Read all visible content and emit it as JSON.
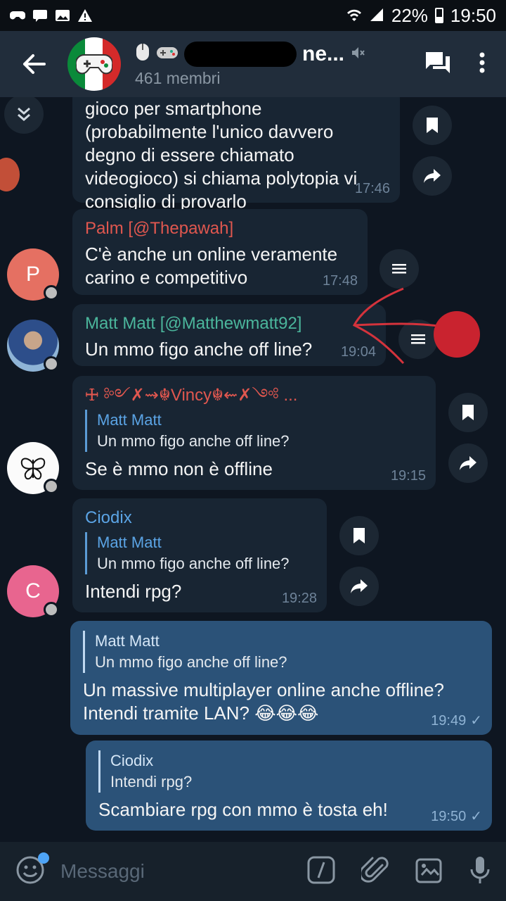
{
  "status_bar": {
    "battery": "22%",
    "time": "19:50"
  },
  "header": {
    "title_visible": "ne...",
    "subtitle": "461 membri"
  },
  "messages": [
    {
      "text": "gioco per smartphone (probabilmente l'unico davvero degno di essere chiamato videogioco) si chiama polytopia vi consiglio di provarlo",
      "lines": [
        "gioco per smartphone",
        "(probabilmente l'unico davvero",
        "degno di essere chiamato",
        "videogioco) si chiama polytopia vi",
        "consiglio di provarlo"
      ],
      "time": "17:46"
    },
    {
      "sender": "Palm [@Thepawah]",
      "avatar_letter": "P",
      "lines": [
        "C'è anche un online veramente",
        "carino e competitivo"
      ],
      "time": "17:48"
    },
    {
      "sender": "Matt Matt [@Matthewmatt92]",
      "lines": [
        "Un mmo figo anche off line?"
      ],
      "time": "19:04"
    },
    {
      "sender": "🜊 ༻✗⇝☬Vincy☬⇜✗༺ ...",
      "reply_name": "Matt Matt",
      "reply_text": "Un mmo figo anche off line?",
      "lines": [
        "Se è mmo non è offline"
      ],
      "time": "19:15"
    },
    {
      "sender": "Ciodix",
      "avatar_letter": "C",
      "reply_name": "Matt Matt",
      "reply_text": "Un mmo figo anche off line?",
      "lines": [
        "Intendi rpg?"
      ],
      "time": "19:28"
    },
    {
      "reply_name": "Matt Matt",
      "reply_text": "Un mmo figo anche off line?",
      "lines": [
        "Un massive multiplayer online anche offline?",
        "Intendi tramite LAN? 😂😂😂"
      ],
      "time": "19:49"
    },
    {
      "reply_name": "Ciodix",
      "reply_text": "Intendi rpg?",
      "lines": [
        "Scambiare rpg con mmo è tosta eh!"
      ],
      "time": "19:50"
    }
  ],
  "input": {
    "placeholder": "Messaggi"
  },
  "colors": {
    "header_bg": "#212d3b",
    "chat_bg": "#0e1621",
    "bubble_in": "#182533",
    "bubble_out": "#2b5278",
    "palm_name": "#e0574f",
    "matt_name": "#4bb69c",
    "vincy_name": "#e0574f",
    "ciodix_name": "#5ba4e5",
    "avatar_p": "#e57062",
    "avatar_c": "#e8658f"
  }
}
